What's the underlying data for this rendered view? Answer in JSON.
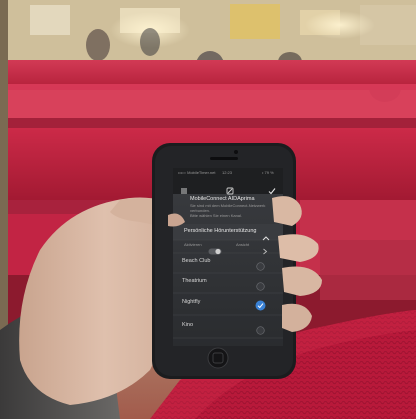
{
  "scene": {
    "description_colors": {
      "seat_red": "#c8203f",
      "phone_black": "#1b1c1e",
      "screen_bg": "#2f3134",
      "skin": "#d5b6a2",
      "check_blue": "#3a82d6"
    }
  },
  "phone": {
    "status": {
      "carrier": "••••○ MobileTimer.net",
      "time": "12:23",
      "battery": "• 79 %"
    },
    "toolbar": {
      "close_icon": "close-icon",
      "display_icon": "display-icon",
      "confirm_icon": "checkmark-icon"
    },
    "app_name": "MobileConnect AIDAprima",
    "intro_lines": [
      "Sie sind mit dem MobileConnect-Netzwerk",
      "verbunden.",
      "Bitte wählen Sie einen Kanal."
    ],
    "section_title": "Persönliche Hörunterstützung",
    "toggle": {
      "left_label": "Aktivieren",
      "right_label": "Ansicht"
    },
    "channels": [
      {
        "name": "Beach Club",
        "selected": false
      },
      {
        "name": "Theatrium",
        "selected": false
      },
      {
        "name": "Nightfly",
        "selected": true
      },
      {
        "name": "Kino",
        "selected": false
      }
    ]
  }
}
